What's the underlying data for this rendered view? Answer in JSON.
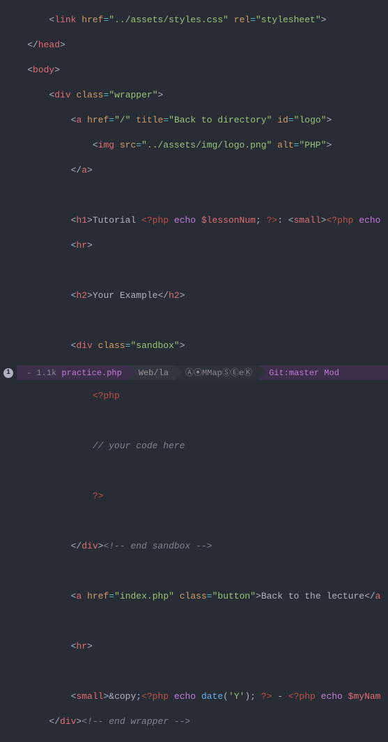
{
  "code": {
    "l1_href": "../assets/styles.css",
    "l1_rel": "stylesheet",
    "head": "head",
    "body": "body",
    "div": "div",
    "a": "a",
    "img": "img",
    "h1": "h1",
    "h2": "h2",
    "hr": "hr",
    "small": "small",
    "wrapper": "wrapper",
    "slash": "/",
    "title_attr": "Back to directory",
    "logo_id": "logo",
    "img_src": "../assets/img/logo.png",
    "alt": "PHP",
    "tutorial_text": "Tutorial ",
    "php_open": "<?php",
    "php_close": "?>",
    "echo": "echo",
    "lessonNum": "$lessonNum",
    "colon_small": ": <",
    "your_example": "Your Example",
    "sandbox": "sandbox",
    "your_code": "// your code here",
    "end_sandbox": "<!-- end sandbox -->",
    "index_href": "index.php",
    "button_class": "button",
    "back_lecture": "Back to the lecture",
    "copy": "&copy;",
    "date": "date",
    "date_arg": "'Y'",
    "dash": " - ",
    "myNam": "$myNam",
    "end_wrapper": "<!-- end wrapper -->",
    "link_tag": "link",
    "href_attr": "href",
    "rel_attr": "rel",
    "class_attr": "class",
    "title_attrname": "title",
    "id_attr": "id",
    "src_attr": "src",
    "alt_attr": "alt"
  },
  "status": {
    "badge": "1",
    "seg_a_prefix": "- 1.1k",
    "seg_a_file": "practice.php",
    "seg_b": "Web/la",
    "seg_c": "Ⓐ⦿MMapⓈⒺeⓀ",
    "seg_d": "Git:master Mod"
  }
}
